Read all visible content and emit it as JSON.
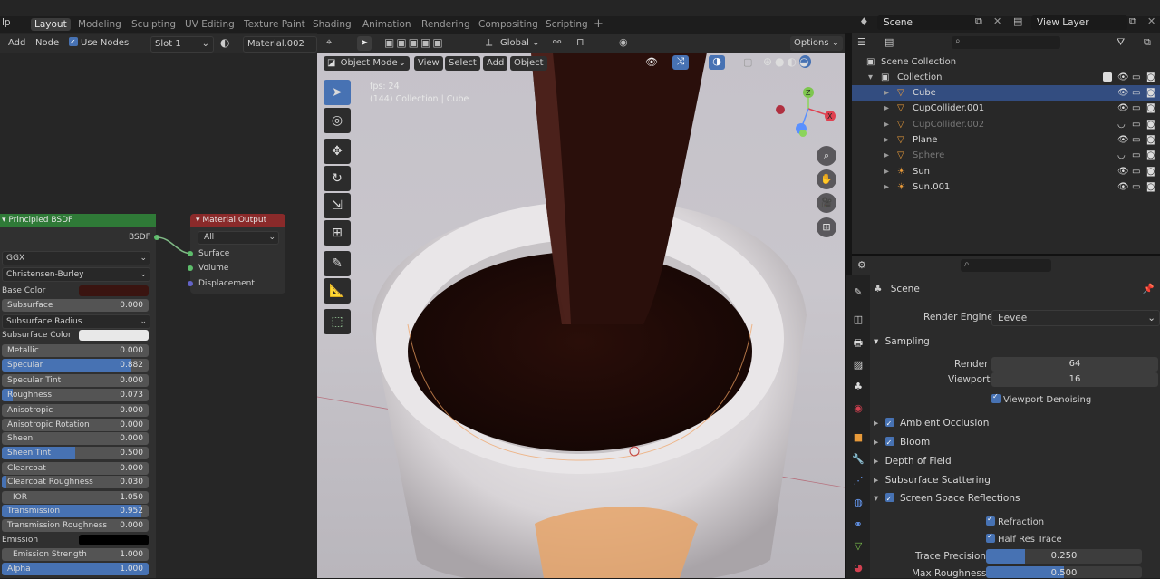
{
  "workspace_tabs": [
    "Layout",
    "Modeling",
    "Sculpting",
    "UV Editing",
    "Texture Paint",
    "Shading",
    "Animation",
    "Rendering",
    "Compositing",
    "Scripting"
  ],
  "topbar": {
    "help_fragment": "lp",
    "scene_label": "Scene",
    "view_layer_label": "View Layer",
    "add_tab": "+"
  },
  "node_header": {
    "add": "Add",
    "node": "Node",
    "use_nodes": "Use Nodes",
    "slot": "Slot 1",
    "material": "Material.002"
  },
  "principled": {
    "title": "Principled BSDF",
    "output": "BSDF",
    "distribution": "GGX",
    "subsurface_method": "Christensen-Burley",
    "base_color_label": "Base Color",
    "base_color": "#3a1410",
    "subsurface_radius": "Subsurface Radius",
    "subsurface_color_label": "Subsurface Color",
    "emission_label": "Emission",
    "rows": [
      {
        "label": "Subsurface",
        "value": "0.000",
        "fill": 0
      },
      {
        "label": "Metallic",
        "value": "0.000",
        "fill": 0
      },
      {
        "label": "Specular",
        "value": "0.882",
        "fill": 0.882
      },
      {
        "label": "Specular Tint",
        "value": "0.000",
        "fill": 0
      },
      {
        "label": "Roughness",
        "value": "0.073",
        "fill": 0.073
      },
      {
        "label": "Anisotropic",
        "value": "0.000",
        "fill": 0
      },
      {
        "label": "Anisotropic Rotation",
        "value": "0.000",
        "fill": 0
      },
      {
        "label": "Sheen",
        "value": "0.000",
        "fill": 0
      },
      {
        "label": "Sheen Tint",
        "value": "0.500",
        "fill": 0.5
      },
      {
        "label": "Clearcoat",
        "value": "0.000",
        "fill": 0
      },
      {
        "label": "Clearcoat Roughness",
        "value": "0.030",
        "fill": 0.03
      },
      {
        "label": "IOR",
        "value": "1.050",
        "fill": 0
      },
      {
        "label": "Transmission",
        "value": "0.952",
        "fill": 0.952
      },
      {
        "label": "Transmission Roughness",
        "value": "0.000",
        "fill": 0
      },
      {
        "label": "Emission Strength",
        "value": "1.000",
        "fill": 0
      },
      {
        "label": "Alpha",
        "value": "1.000",
        "fill": 1
      }
    ]
  },
  "material_output": {
    "title": "Material Output",
    "target": "All",
    "surface": "Surface",
    "volume": "Volume",
    "displacement": "Displacement"
  },
  "viewport_header": {
    "orientation": "Global",
    "options": "Options",
    "mode": "Object Mode",
    "view": "View",
    "select": "Select",
    "add": "Add",
    "object": "Object"
  },
  "viewport_overlay": {
    "fps": "fps: 24",
    "collection": "(144) Collection | Cube"
  },
  "outliner": {
    "root": "Scene Collection",
    "collection": "Collection",
    "items": [
      {
        "name": "Cube",
        "selected": true,
        "dim": false
      },
      {
        "name": "CupCollider.001",
        "selected": false,
        "dim": false
      },
      {
        "name": "CupCollider.002",
        "selected": false,
        "dim": true
      },
      {
        "name": "Plane",
        "selected": false,
        "dim": false
      },
      {
        "name": "Sphere",
        "selected": false,
        "dim": true
      },
      {
        "name": "Sun",
        "selected": false,
        "dim": false
      },
      {
        "name": "Sun.001",
        "selected": false,
        "dim": false
      }
    ]
  },
  "properties": {
    "context": "Scene",
    "render_engine_label": "Render Engine",
    "render_engine": "Eevee",
    "sampling": "Sampling",
    "render_label": "Render",
    "render_value": "64",
    "viewport_label": "Viewport",
    "viewport_value": "16",
    "viewport_denoising": "Viewport Denoising",
    "panels": [
      "Ambient Occlusion",
      "Bloom",
      "Depth of Field",
      "Subsurface Scattering",
      "Screen Space Reflections"
    ],
    "refraction": "Refraction",
    "half_res_trace": "Half Res Trace",
    "trace_precision_label": "Trace Precision",
    "trace_precision": "0.250",
    "trace_precision_fill": 0.25,
    "max_roughness_label": "Max Roughness",
    "max_roughness": "0.500"
  },
  "colors": {
    "accent": "#4772b3",
    "node_green": "#2f7a37",
    "node_red": "#8a2a2a",
    "outliner_sel": "#334d80"
  }
}
